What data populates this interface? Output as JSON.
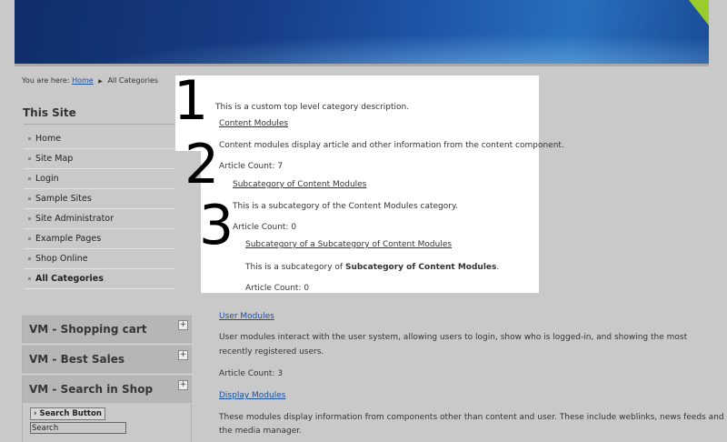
{
  "breadcrumb": {
    "prefix": "You are here:",
    "home": "Home",
    "current": "All Categories"
  },
  "sidebar": {
    "title": "This Site",
    "items": [
      {
        "label": "Home"
      },
      {
        "label": "Site Map"
      },
      {
        "label": "Login"
      },
      {
        "label": "Sample Sites"
      },
      {
        "label": "Site Administrator"
      },
      {
        "label": "Example Pages"
      },
      {
        "label": "Shop Online"
      },
      {
        "label": "All Categories"
      }
    ]
  },
  "modules": {
    "cart": "VM - Shopping cart",
    "best_sales": "VM - Best Sales",
    "search_shop": "VM - Search in Shop",
    "expand": "+",
    "search_button": "Search Button",
    "search_value": "Search"
  },
  "overlay": {
    "numbers": [
      "1",
      "2",
      "3"
    ],
    "top_description": "This is a custom top level category description.",
    "content_modules_link": "Content Modules",
    "content_modules_desc": "Content modules display article and other information from the content component.",
    "article_count_7": "Article Count: 7",
    "subcat_link": "Subcategory of Content Modules",
    "subcat_desc": "This is a subcategory of the Content Modules category.",
    "article_count_0a": "Article Count: 0",
    "subsubcat_link": "Subcategory of a Subcategory of Content Modules",
    "subsubcat_desc_prefix": "This is a subcategory of ",
    "subsubcat_desc_bold": "Subcategory of Content Modules",
    "subsubcat_desc_suffix": ".",
    "article_count_0b": "Article Count: 0"
  },
  "main": {
    "user_modules_link": "User Modules",
    "user_modules_desc_1": "User modules interact with the user system, allowing users to login, show who is logged-in, and showing the most",
    "user_modules_desc_2": "recently registered users.",
    "article_count_3": "Article Count: 3",
    "display_modules_link": "Display Modules",
    "display_modules_desc_1": "These modules display information from components other than content and user. These include weblinks, news feeds and",
    "display_modules_desc_2": "the media manager."
  },
  "colors": {
    "link": "#1b4f9c",
    "banner": "#173d86",
    "accent": "#9acd2c"
  }
}
